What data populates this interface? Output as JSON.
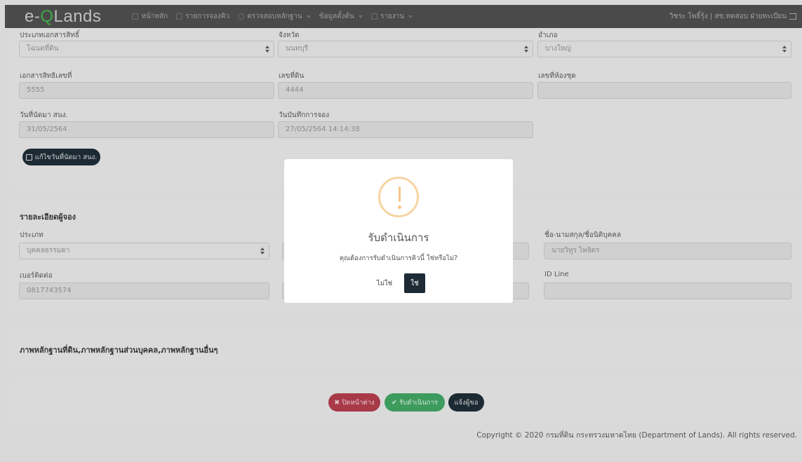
{
  "navbar": {
    "logo_prefix": "e-",
    "logo_q": "Q",
    "logo_suffix": "Lands",
    "menu": [
      {
        "label": "หน้าหลัก",
        "icon": "home-icon"
      },
      {
        "label": "รายการจองคิว",
        "icon": "mail-icon"
      },
      {
        "label": "ตรวจสอบหลักฐาน",
        "icon": "search-icon"
      },
      {
        "label": "ข้อมูลตั้งต้น",
        "icon": "gear-icon"
      },
      {
        "label": "รายงาน",
        "icon": "print-icon"
      }
    ],
    "user": "วิชระ โพธิ์รุ้ง | สข.ทดสอบ ฝ่ายทะเบียน"
  },
  "document": {
    "doc_type_label": "ประเภทเอกสารสิทธิ์",
    "doc_type_value": "โฉนดที่ดิน",
    "province_label": "จังหวัด",
    "province_value": "นนทบุรี",
    "district_label": "อำเภอ",
    "district_value": "บางใหญ่",
    "doc_no_label": "เอกสารสิทธิเลขที่",
    "doc_no_value": "5555",
    "land_no_label": "เลขที่ดิน",
    "land_no_value": "4444",
    "room_no_label": "เลขที่ห้องชุด",
    "room_no_value": "",
    "appt_date_label": "วันที่นัดมา สนง.",
    "appt_date_value": "31/05/2564",
    "record_date_label": "วันบันทึกการจอง",
    "record_date_value": "27/05/2564 14:14:38",
    "edit_button": "แก้ไขวันที่นัดมา สนง."
  },
  "person": {
    "section_title": "รายละเอียดผู้จอง",
    "type_label": "ประเภท",
    "type_value": "บุคคลธรรมดา",
    "name_label": "ชื่อ-นามสกุล/ชื่อนิติบุคคล",
    "name_value": "นายวิทูร ไพจิตร",
    "phone_label": "เบอร์ติดต่อ",
    "phone_value": "0817743574",
    "line_label": "ID Line",
    "line_value": ""
  },
  "photos": {
    "section_title": "ภาพหลักฐานที่ดิน,ภาพหลักฐานส่วนบุคคล,ภาพหลักฐานอื่นๆ"
  },
  "actions": {
    "close_label": "ปิดหน้าต่าง",
    "accept_label": "รับดำเนินการ",
    "notify_label": "แจ้งผู้ขอ"
  },
  "footer": {
    "copyright": "Copyright © 2020 กรมที่ดิน กระทรวงมหาดไทย (Department of Lands). All rights reserved."
  },
  "modal": {
    "title": "รับดำเนินการ",
    "text": "คุณต้องการรับดำเนินการคิวนี้ ใช่หรือไม่?",
    "no_label": "ไม่ใช่",
    "yes_label": "ใช่"
  },
  "colors": {
    "navbar": "#4a4a4a",
    "logo_accent": "#3fa84a",
    "warning": "#f5c48a",
    "danger": "#a83a48",
    "success": "#3e9b5e",
    "dark_button": "#1c2a33"
  }
}
